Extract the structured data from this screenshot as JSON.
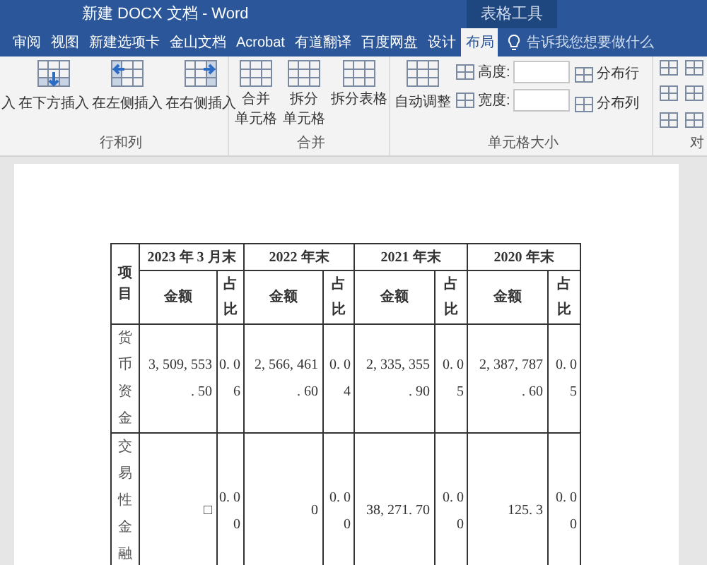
{
  "window": {
    "title": "新建 DOCX 文档 - Word",
    "context_tab": "表格工具"
  },
  "tabs": [
    {
      "label": "审阅",
      "selected": false
    },
    {
      "label": "视图",
      "selected": false
    },
    {
      "label": "新建选项卡",
      "selected": false
    },
    {
      "label": "金山文档",
      "selected": false
    },
    {
      "label": "Acrobat",
      "selected": false
    },
    {
      "label": "有道翻译",
      "selected": false
    },
    {
      "label": "百度网盘",
      "selected": false
    },
    {
      "label": "设计",
      "selected": false
    },
    {
      "label": "布局",
      "selected": true
    }
  ],
  "tell_me": "告诉我您想要做什么",
  "ribbon": {
    "groups": [
      {
        "label": "行和列",
        "buttons": [
          {
            "label": "入",
            "kind": "plain"
          },
          {
            "label": "在下方插入",
            "kind": "below"
          },
          {
            "label": "在左侧插入",
            "kind": "left"
          },
          {
            "label": "在右侧插入",
            "kind": "right"
          }
        ]
      },
      {
        "label": "合并",
        "buttons": [
          {
            "label": [
              "合并",
              "单元格"
            ],
            "kind": "merge"
          },
          {
            "label": [
              "拆分",
              "单元格"
            ],
            "kind": "split"
          },
          {
            "label": [
              "拆分表格"
            ],
            "kind": "splittable"
          }
        ]
      },
      {
        "label": "单元格大小",
        "autofit": "自动调整",
        "height_label": "高度:",
        "width_label": "宽度:",
        "distribute_rows": "分布行",
        "distribute_cols": "分布列"
      }
    ],
    "cut_group_label": "对"
  },
  "table": {
    "item_header": "项目",
    "periods": [
      {
        "label": "2023 年 3 月末",
        "amount_header": "金额",
        "ratio_header": "占比"
      },
      {
        "label": "2022 年末",
        "amount_header": "金额",
        "ratio_header": "占比"
      },
      {
        "label": "2021 年末",
        "amount_header": "金额",
        "ratio_header": "占比"
      },
      {
        "label": "2020 年末",
        "amount_header": "金额",
        "ratio_header": "占比"
      }
    ],
    "rows": [
      {
        "item": "货币资金",
        "cells": [
          {
            "amount": [
              "3, 509, 553",
              ". 50"
            ],
            "ratio": [
              "0. 0",
              "6"
            ]
          },
          {
            "amount": [
              "2, 566, 461",
              ". 60"
            ],
            "ratio": [
              "0. 0",
              "4"
            ]
          },
          {
            "amount": [
              "2, 335, 355",
              ". 90"
            ],
            "ratio": [
              "0. 0",
              "5"
            ]
          },
          {
            "amount": [
              "2, 387, 787",
              ". 60"
            ],
            "ratio": [
              "0. 0",
              "5"
            ]
          }
        ]
      },
      {
        "item": "交易性金融",
        "cells": [
          {
            "amount": [
              "□"
            ],
            "ratio": [
              "0. 0",
              "0"
            ]
          },
          {
            "amount": [
              "0"
            ],
            "ratio": [
              "0. 0",
              "0"
            ]
          },
          {
            "amount": [
              "38, 271. 70"
            ],
            "ratio": [
              "0. 0",
              "0"
            ]
          },
          {
            "amount": [
              "125. 3"
            ],
            "ratio": [
              "0. 0",
              "0"
            ]
          }
        ]
      }
    ]
  }
}
